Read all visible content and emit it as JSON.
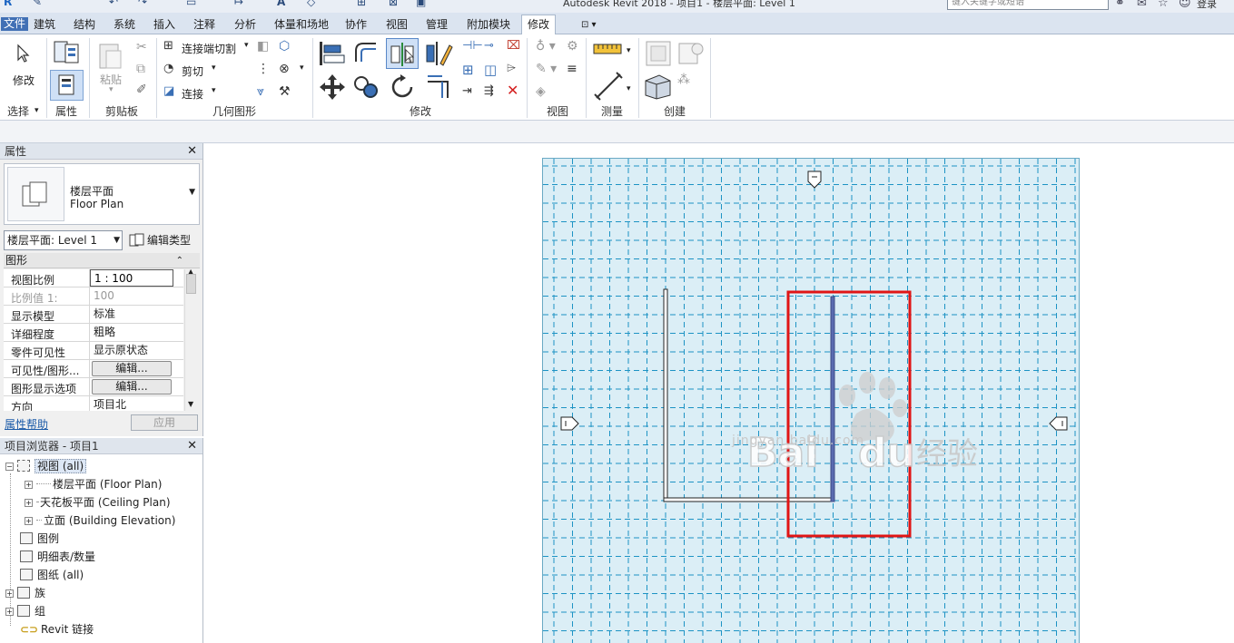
{
  "app": {
    "title": "Autodesk Revit 2018 -   项目1 - 楼层平面: Level 1",
    "search_placeholder": "键入关键字或短语",
    "login_label": "登录"
  },
  "tabs": [
    {
      "label": "文件"
    },
    {
      "label": "建筑"
    },
    {
      "label": "结构"
    },
    {
      "label": "系统"
    },
    {
      "label": "插入"
    },
    {
      "label": "注释"
    },
    {
      "label": "分析"
    },
    {
      "label": "体量和场地"
    },
    {
      "label": "协作"
    },
    {
      "label": "视图"
    },
    {
      "label": "管理"
    },
    {
      "label": "附加模块"
    },
    {
      "label": "修改"
    }
  ],
  "ribbon": {
    "modify_label": "修改",
    "clipboard": {
      "paste_label": "粘贴"
    },
    "geometry": {
      "join_cut_label": "连接端切割",
      "cut_label": "剪切",
      "join_label": "连接"
    },
    "panels": {
      "select": "选择",
      "properties": "属性",
      "clipboard": "剪贴板",
      "geometry": "几何图形",
      "modify": "修改",
      "view": "视图",
      "measure": "测量",
      "create": "创建"
    }
  },
  "properties": {
    "header": "属性",
    "type_name_cn": "楼层平面",
    "type_name_en": "Floor Plan",
    "instance_selector": "楼层平面: Level 1",
    "edit_type_label": "编辑类型",
    "group_label": "图形",
    "rows": [
      {
        "key": "视图比例",
        "value": "1 : 100"
      },
      {
        "key": "比例值 1:",
        "value": "100"
      },
      {
        "key": "显示模型",
        "value": "标准"
      },
      {
        "key": "详细程度",
        "value": "粗略"
      },
      {
        "key": "零件可见性",
        "value": "显示原状态"
      },
      {
        "key": "可见性/图形...",
        "value": "编辑..."
      },
      {
        "key": "图形显示选项",
        "value": "编辑..."
      },
      {
        "key": "方向",
        "value": "项目北"
      }
    ],
    "help_link": "属性帮助",
    "apply_label": "应用"
  },
  "project_browser": {
    "header": "项目浏览器 - 项目1",
    "nodes": [
      {
        "label": "视图 (all)"
      },
      {
        "label": "楼层平面 (Floor Plan)"
      },
      {
        "label": "天花板平面 (Ceiling Plan)"
      },
      {
        "label": "立面 (Building Elevation)"
      },
      {
        "label": "图例"
      },
      {
        "label": "明细表/数量"
      },
      {
        "label": "图纸 (all)"
      },
      {
        "label": "族"
      },
      {
        "label": "组"
      },
      {
        "label": "Revit 链接"
      }
    ]
  },
  "watermark": {
    "brand": "Baidu经验",
    "url": "jingyan.baidu.com"
  },
  "colors": {
    "file_tab": "#4170b5",
    "sheet_bg": "#dbeef6",
    "grid_line": "#1d93c4",
    "selection_box": "#e01515",
    "selected_wall": "#5a6bb0"
  }
}
